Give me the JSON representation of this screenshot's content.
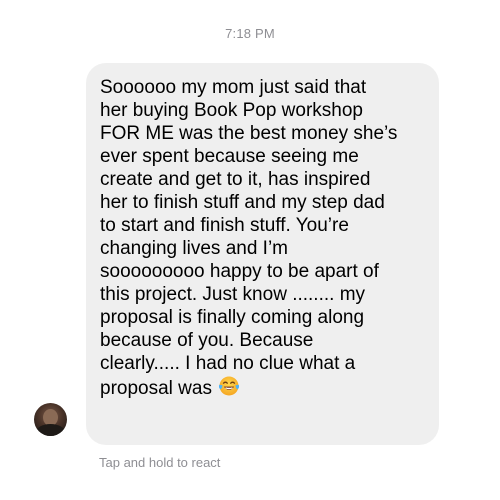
{
  "thread": {
    "timestamp": "7:18 PM",
    "react_hint": "Tap and hold to react"
  },
  "message": {
    "lines": [
      "Soooooo my mom just said that",
      "her buying Book Pop workshop",
      "FOR ME was the best money she’s",
      "ever spent because seeing me",
      "create and get to it, has inspired",
      "her to finish stuff and my step dad",
      "to start and finish stuff. You’re",
      "changing lives and I’m",
      "sooooooooo happy to be apart of",
      "this project. Just know ........ my",
      "proposal is finally coming along",
      "because of you. Because",
      "clearly..... I had no clue what a",
      "proposal was"
    ],
    "emoji": "face-with-tears-of-joy-icon",
    "bubble_color": "#efefef"
  },
  "sender": {
    "avatar": "avatar"
  },
  "colors": {
    "meta_text": "#8e8e93",
    "message_text": "#000000"
  }
}
